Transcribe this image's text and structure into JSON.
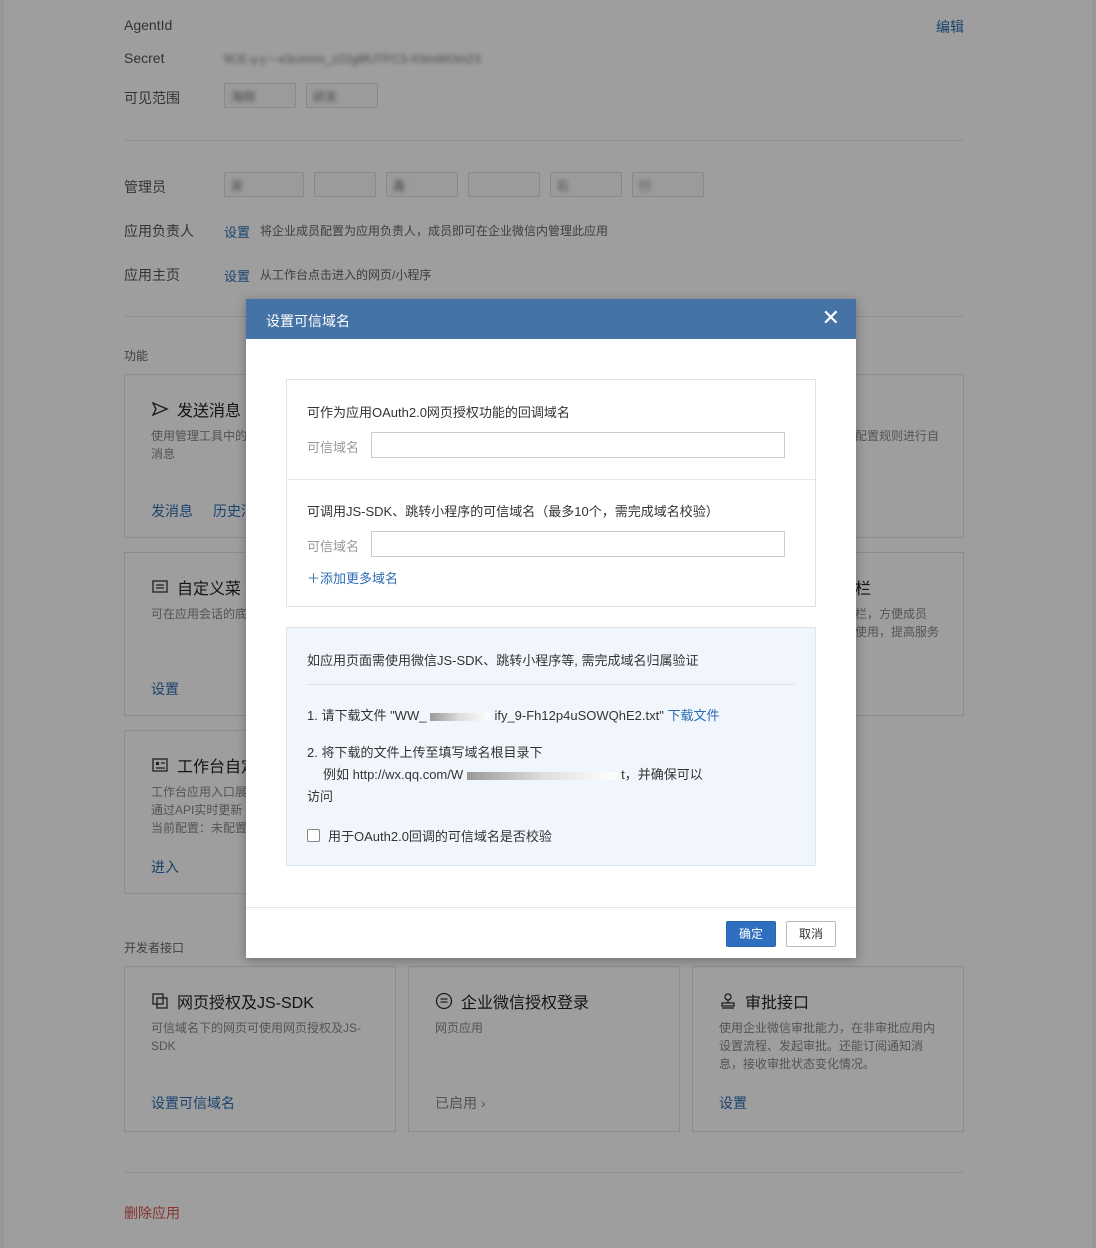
{
  "app": {
    "agentid_label": "AgentId",
    "edit_label": "编辑",
    "secret_label": "Secret",
    "secret_value": "ftCE-y-j-~-e3cmmn_z22g8fUTFC3-XSmWOm23",
    "visible_label": "可见范围",
    "visible_chips": [
      "海翔",
      "研发"
    ],
    "admins_label": "管理员",
    "admin_chips": [
      "吴",
      "",
      "鑫",
      "",
      "石",
      "行"
    ],
    "owner_label": "应用负责人",
    "owner_action": "设置",
    "owner_desc": "将企业成员配置为应用负责人，成员即可在企业微信内管理此应用",
    "home_label": "应用主页",
    "home_action": "设置",
    "home_desc": "从工作台点击进入的网页/小程序",
    "features_label": "功能",
    "dev_label": "开发者接口",
    "delete_label": "删除应用"
  },
  "features": [
    {
      "title": "发送消息",
      "desc": "使用管理工具中的",
      "desc2": "消息",
      "link": "发消息",
      "link2": "历史消",
      "right_desc": "配置规则进行自",
      "icon": "send-icon"
    },
    {
      "title": "自定义菜",
      "desc": "可在应用会话的底",
      "link": "设置",
      "right_title": "栏",
      "right_desc": "栏，方便成员",
      "right_desc2": "使用，提高服务",
      "icon": "menu-icon"
    },
    {
      "title": "工作台自定",
      "desc": "工作台应用入口展",
      "desc2": "通过API实时更新",
      "desc3": "当前配置：未配置",
      "link": "进入",
      "icon": "workbench-icon"
    }
  ],
  "dev_cards": [
    {
      "title": "网页授权及JS-SDK",
      "desc": "可信域名下的网页可使用网页授权及JS-",
      "desc2": "SDK",
      "link": "设置可信域名",
      "icon": "copy-icon"
    },
    {
      "title": "企业微信授权登录",
      "desc": "网页应用",
      "link": "已启用",
      "icon": "list-icon"
    },
    {
      "title": "审批接口",
      "desc": "使用企业微信审批能力，在非审批应用内",
      "desc2": "设置流程、发起审批。还能订阅通知消",
      "desc3": "息，接收审批状态变化情况。",
      "link": "设置",
      "icon": "stamp-icon"
    }
  ],
  "dialog": {
    "title": "设置可信域名",
    "oauth_question": "可作为应用OAuth2.0网页授权功能的回调域名",
    "field_label": "可信域名",
    "field_value": "",
    "jssdk_question": "可调用JS-SDK、跳转小程序的可信域名（最多10个，需完成域名校验）",
    "field_label2": "可信域名",
    "field_value2": "",
    "add_more": "添加更多域名",
    "verify_title": "如应用页面需使用微信JS-SDK、跳转小程序等, 需完成域名归属验证",
    "step1_prefix": "1. 请下载文件 \"WW_",
    "step1_file": "ify_9-Fh12p4uSOWQhE2.txt\"",
    "step1_link": "下载文件",
    "step2_line1": "2. 将下载的文件上传至填写域名根目录下",
    "step2_line2_prefix": "例如 http://wx.qq.com/W",
    "step2_line2_suffix": "t，并确保可以",
    "step2_line3": "访问",
    "checkbox_label": "用于OAuth2.0回调的可信域名是否校验",
    "ok": "确定",
    "cancel": "取消"
  }
}
